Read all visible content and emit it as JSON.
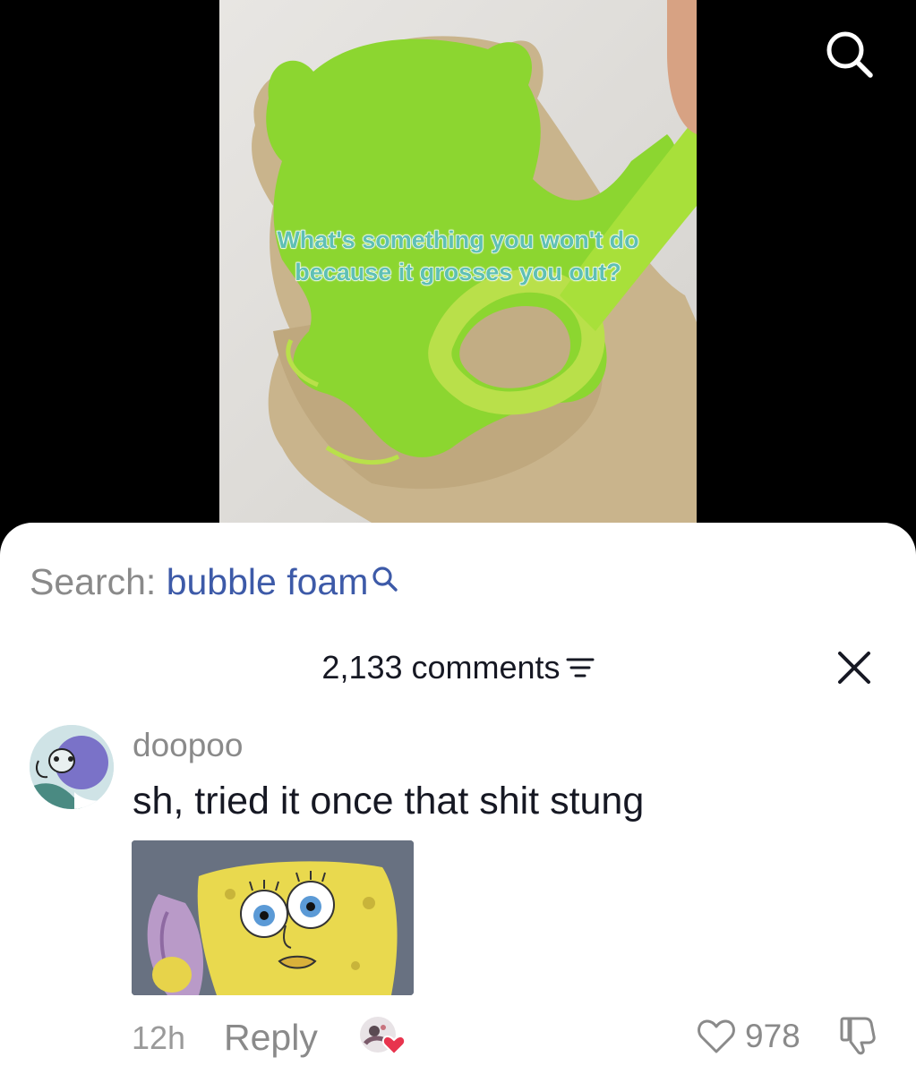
{
  "video": {
    "caption_line1": "What's something you won't do",
    "caption_line2": "because it grosses you out?",
    "search_icon": "search-icon"
  },
  "search_bar": {
    "prefix": "Search: ",
    "term": "bubble foam",
    "icon": "search-icon"
  },
  "comments_header": {
    "count_label": "2,133 comments",
    "filter_icon": "filter-icon",
    "close_icon": "close-icon"
  },
  "comment": {
    "username": "doopoo",
    "text": "sh, tried it once that shit stung",
    "avatar_icon": "cartoon-avatar",
    "image": "spongebob-reaction-image",
    "timestamp": "12h",
    "reply_label": "Reply",
    "creator_liked_icon": "creator-liked-avatar-heart",
    "like_icon": "heart-outline-icon",
    "like_count": "978",
    "dislike_icon": "thumbs-down-icon"
  },
  "colors": {
    "background": "#000000",
    "sheet": "#ffffff",
    "search_term": "#3d5aa8",
    "muted_text": "#8a8a8a",
    "primary_text": "#161823",
    "caption": "#5fc0b4",
    "heart_red": "#e8344e",
    "cookie_icing": "#8cd630"
  }
}
